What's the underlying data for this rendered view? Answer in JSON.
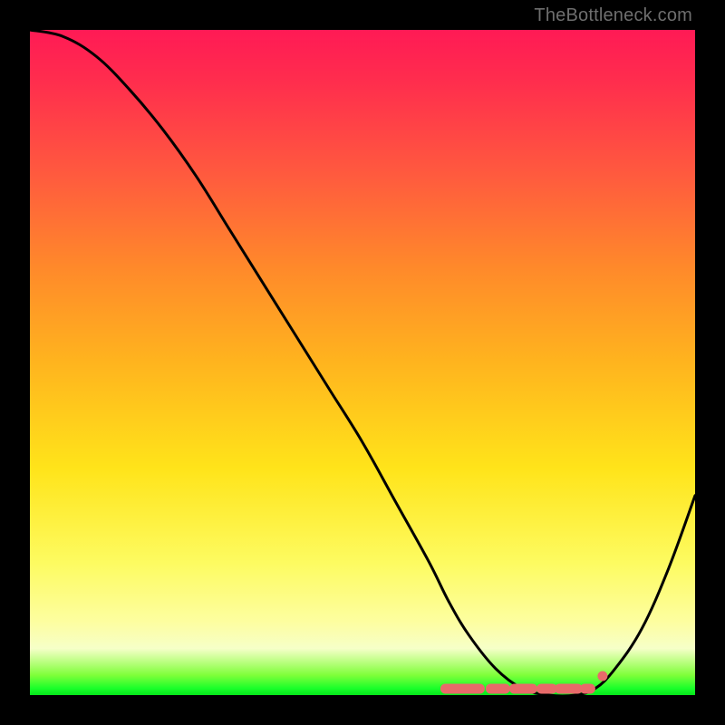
{
  "attribution": "TheBottleneck.com",
  "colors": {
    "background": "#000000",
    "gradient_top": "#ff1a55",
    "gradient_mid": "#ffe41a",
    "gradient_bottom": "#05e61a",
    "curve": "#000000",
    "markers": "#e86a6a"
  },
  "chart_data": {
    "type": "line",
    "title": "",
    "xlabel": "",
    "ylabel": "",
    "xlim": [
      0,
      100
    ],
    "ylim": [
      0,
      100
    ],
    "x": [
      0,
      5,
      10,
      15,
      20,
      25,
      30,
      35,
      40,
      45,
      50,
      55,
      60,
      63,
      66,
      70,
      74,
      78,
      82,
      85,
      88,
      92,
      96,
      100
    ],
    "values": [
      100,
      99,
      96,
      91,
      85,
      78,
      70,
      62,
      54,
      46,
      38,
      29,
      20,
      14,
      9,
      4,
      1,
      0,
      0,
      1,
      4,
      10,
      19,
      30
    ],
    "highlight_region": {
      "x_start": 63,
      "x_end": 85
    },
    "annotations": []
  }
}
